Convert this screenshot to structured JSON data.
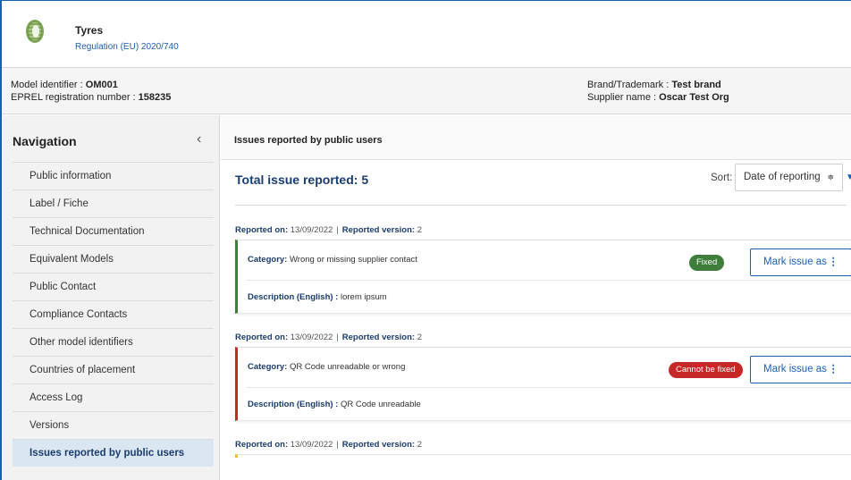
{
  "product": {
    "title": "Tyres",
    "regulation": "Regulation (EU) 2020/740",
    "icon": "tyre-icon"
  },
  "info": {
    "model_label": "Model identifier : ",
    "model_value": "OM001",
    "eprel_label": "EPREL registration number : ",
    "eprel_value": "158235",
    "brand_label": "Brand/Trademark : ",
    "brand_value": "Test brand",
    "supplier_label": "Supplier name : ",
    "supplier_value": "Oscar Test Org"
  },
  "sidebar": {
    "title": "Navigation",
    "collapse_icon": "chevron-left-icon",
    "items": [
      {
        "label": "Public information",
        "active": false
      },
      {
        "label": "Label / Fiche",
        "active": false
      },
      {
        "label": "Technical Documentation",
        "active": false
      },
      {
        "label": "Equivalent Models",
        "active": false
      },
      {
        "label": "Public Contact",
        "active": false
      },
      {
        "label": "Compliance Contacts",
        "active": false
      },
      {
        "label": "Other model identifiers",
        "active": false
      },
      {
        "label": "Countries of placement",
        "active": false
      },
      {
        "label": "Access Log",
        "active": false
      },
      {
        "label": "Versions",
        "active": false
      },
      {
        "label": "Issues reported by public users",
        "active": true
      }
    ]
  },
  "main": {
    "header": "Issues reported by public users",
    "total": "Total issue reported: 5",
    "sort_label": "Sort:",
    "sort_value": "Date of reporting",
    "sort_arrows": "≑",
    "reported_on_label": "Reported on:",
    "reported_version_label": "Reported version:",
    "category_label": "Category:",
    "description_label": "Description (English) :",
    "mark_label": "Mark issue as",
    "mark_dots": "⋮",
    "issues": [
      {
        "reported_on": "13/09/2022",
        "version": "2",
        "category": "Wrong or missing supplier contact",
        "status": "Fixed",
        "status_color": "#3e7d3a",
        "description": "lorem ipsum"
      },
      {
        "reported_on": "13/09/2022",
        "version": "2",
        "category": "QR Code unreadable or wrong",
        "status": "Cannot be fixed",
        "status_color": "#c62828",
        "description": "QR Code unreadable"
      },
      {
        "reported_on": "13/09/2022",
        "version": "2"
      }
    ]
  },
  "colors": {
    "accent": "#1a5fb4",
    "nav_active_bg": "#dbe6f3",
    "fixed": "#3e7d3a",
    "not_fixed": "#c62828",
    "pending": "#f2c200"
  }
}
